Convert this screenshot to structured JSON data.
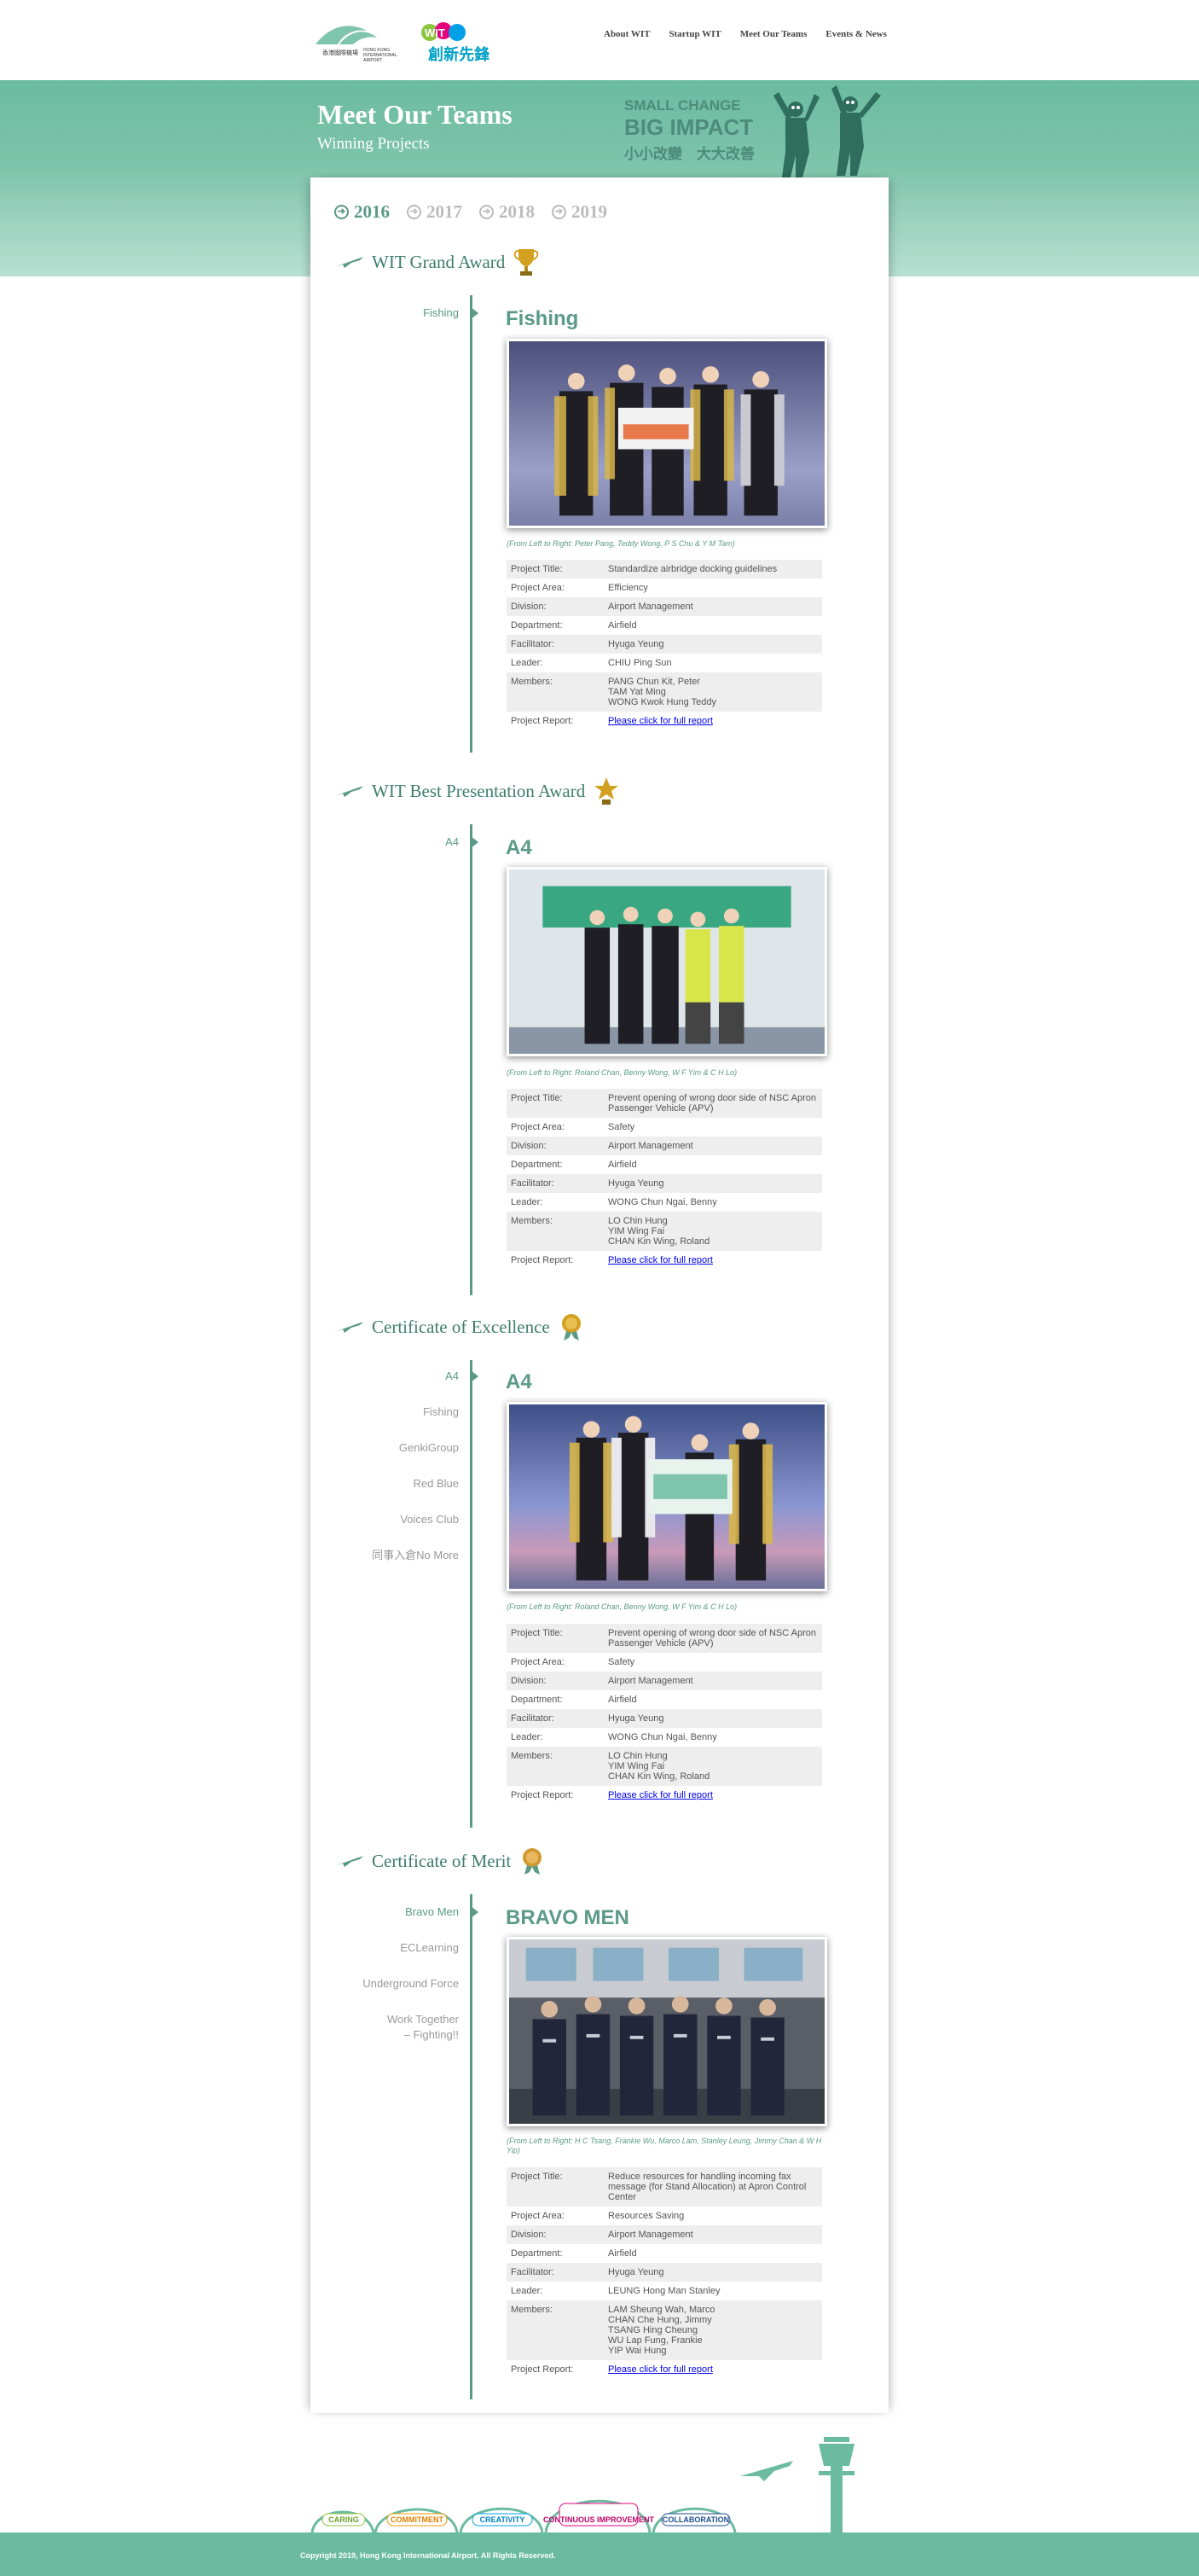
{
  "nav": {
    "items": [
      "About WIT",
      "Startup WIT",
      "Meet Our Teams",
      "Events & News"
    ]
  },
  "hero": {
    "title": "Meet Our Teams",
    "subtitle": "Winning Projects",
    "slogan_en1": "SMALL CHANGE",
    "slogan_en2": "BIG IMPACT",
    "slogan_zh": "小小改變　大大改善"
  },
  "logos": {
    "hkia_zh": "香港國際機場",
    "hkia_en1": "HONG KONG",
    "hkia_en2": "INTERNATIONAL",
    "hkia_en3": "AIRPORT",
    "wit_zh": "創新先鋒",
    "wit": "WIT"
  },
  "years": [
    "2016",
    "2017",
    "2018",
    "2019"
  ],
  "colors": {
    "accent": "#5a9a86",
    "hero": "#6bbba0",
    "link": "#0000ee"
  },
  "sections": [
    {
      "award": "WIT Grand Award",
      "tabs": [
        "Fishing"
      ],
      "project": {
        "title": "Fishing",
        "caption": "(From Left to Right: Peter Pang, Teddy Wong, P S Chu & Y M Tam)",
        "rows": [
          {
            "k": "Project Title:",
            "v": "Standardize airbridge docking guidelines"
          },
          {
            "k": "Project Area:",
            "v": "Efficiency"
          },
          {
            "k": "Division:",
            "v": "Airport Management"
          },
          {
            "k": "Department:",
            "v": "Airfield"
          },
          {
            "k": "Facilitator:",
            "v": "Hyuga Yeung"
          },
          {
            "k": "Leader:",
            "v": "CHIU Ping Sun"
          },
          {
            "k": "Members:",
            "v": "PANG Chun Kit, Peter\nTAM Yat Ming\nWONG Kwok Hung Teddy"
          },
          {
            "k": "Project Report:",
            "v": "Please click for full report"
          }
        ]
      }
    },
    {
      "award": "WIT Best Presentation Award",
      "tabs": [
        "A4"
      ],
      "project": {
        "title": "A4",
        "caption": "(From Left to Right: Roland Chan, Benny Wong, W F Yim & C H Lo)",
        "rows": [
          {
            "k": "Project Title:",
            "v": "Prevent opening of wrong door side of NSC Apron\nPassenger Vehicle (APV)"
          },
          {
            "k": "Project Area:",
            "v": "Safety"
          },
          {
            "k": "Division:",
            "v": "Airport Management"
          },
          {
            "k": "Department:",
            "v": "Airfield"
          },
          {
            "k": "Facilitator:",
            "v": "Hyuga Yeung"
          },
          {
            "k": "Leader:",
            "v": "WONG Chun Ngai, Benny"
          },
          {
            "k": "Members:",
            "v": "LO Chin Hung\nYIM Wing Fai\nCHAN Kin Wing, Roland"
          },
          {
            "k": "Project Report:",
            "v": "Please click for full report"
          }
        ]
      }
    },
    {
      "award": "Certificate of Excellence",
      "tabs": [
        "A4",
        "Fishing",
        "GenkiGroup",
        "Red Blue",
        "Voices Club",
        "同事入倉No More"
      ],
      "project": {
        "title": "A4",
        "caption": "(From Left to Right: Roland Chan, Benny Wong, W F Yim & C H Lo)",
        "rows": [
          {
            "k": "Project Title:",
            "v": "Prevent opening of wrong door side of NSC Apron\nPassenger Vehicle (APV)"
          },
          {
            "k": "Project Area:",
            "v": "Safety"
          },
          {
            "k": "Division:",
            "v": "Airport Management"
          },
          {
            "k": "Department:",
            "v": "Airfield"
          },
          {
            "k": "Facilitator:",
            "v": "Hyuga Yeung"
          },
          {
            "k": "Leader:",
            "v": "WONG Chun Ngai, Benny"
          },
          {
            "k": "Members:",
            "v": "LO Chin Hung\nYIM Wing Fai\nCHAN Kin Wing, Roland"
          },
          {
            "k": "Project Report:",
            "v": "Please click for full report"
          }
        ]
      }
    },
    {
      "award": "Certificate of Merit",
      "tabs": [
        "Bravo Men",
        "ECLearning",
        "Underground Force",
        "Work Together – Fighting!!"
      ],
      "project": {
        "title": "BRAVO MEN",
        "caption": "(From Left to Right: H C Tsang, Frankie Wu, Marco Lam, Stanley Leung, Jimmy Chan & W H Yip)",
        "rows": [
          {
            "k": "Project Title:",
            "v": "Reduce resources for handling incoming fax\nmessage (for Stand Allocation) at Apron Control\nCenter"
          },
          {
            "k": "Project Area:",
            "v": "Resources Saving"
          },
          {
            "k": "Division:",
            "v": "Airport Management"
          },
          {
            "k": "Department:",
            "v": "Airfield"
          },
          {
            "k": "Facilitator:",
            "v": "Hyuga Yeung"
          },
          {
            "k": "Leader:",
            "v": "LEUNG Hong Man Stanley"
          },
          {
            "k": "Members:",
            "v": "LAM Sheung Wah, Marco\nCHAN Che Hung, Jimmy\nTSANG Hing Cheung\nWU Lap Fung, Frankie\nYIP Wai Hung"
          },
          {
            "k": "Project Report:",
            "v": "Please click for full report"
          }
        ]
      }
    }
  ],
  "values_banner": [
    "CARING",
    "COMMITMENT",
    "CREATIVITY",
    "CONTINUOUS IMPROVEMENT",
    "COLLABORATION"
  ],
  "footer": {
    "copyright": "Copyright 2019, Hong Kong International Airport. All Rights Reserved."
  }
}
